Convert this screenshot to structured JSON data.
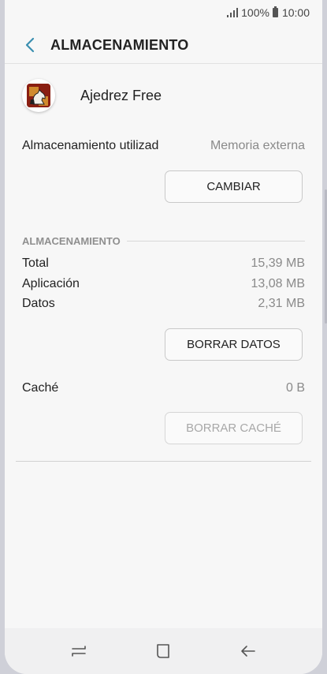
{
  "status_bar": {
    "battery_percent": "100%",
    "time": "10:00"
  },
  "header": {
    "title": "ALMACENAMIENTO",
    "back_icon": "chevron-left-icon",
    "accent_color": "#3a8fb0"
  },
  "app": {
    "name": "Ajedrez Free",
    "icon": "chess-app-icon"
  },
  "storage_location": {
    "label": "Almacenamiento utilizad",
    "value": "Memoria externa",
    "change_button": "CAMBIAR"
  },
  "storage": {
    "section_title": "ALMACENAMIENTO",
    "rows": [
      {
        "label": "Total",
        "value": "15,39 MB"
      },
      {
        "label": "Aplicación",
        "value": "13,08 MB"
      },
      {
        "label": "Datos",
        "value": "2,31 MB"
      }
    ],
    "clear_data_button": "BORRAR DATOS"
  },
  "cache": {
    "label": "Caché",
    "value": "0 B",
    "clear_cache_button": "BORRAR CACHÉ",
    "clear_cache_enabled": false
  },
  "navigation_bar": {
    "buttons": [
      "recent-apps-icon",
      "home-icon",
      "back-arrow-icon"
    ]
  }
}
